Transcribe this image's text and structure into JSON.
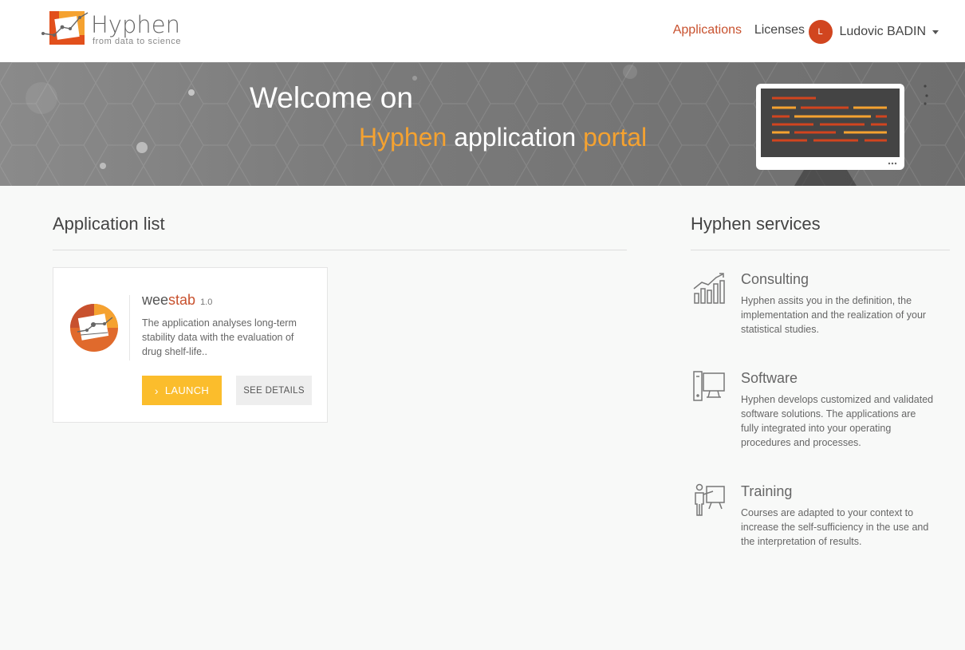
{
  "header": {
    "brand_name": "Hyphen",
    "brand_tagline": "from data to science",
    "nav": [
      {
        "label": "Applications",
        "active": true
      },
      {
        "label": "Licenses",
        "active": false
      }
    ],
    "user": {
      "initial": "L",
      "name": "Ludovic BADIN"
    }
  },
  "banner": {
    "line1": "Welcome on",
    "line2_part1": "Hyphen",
    "line2_part2": " application ",
    "line2_part3": "portal"
  },
  "apps_section": {
    "title": "Application list",
    "apps": [
      {
        "name_part1": "wee",
        "name_part2": "stab",
        "version": "1.0",
        "description": "The application analyses long-term stability data with the evaluation of drug shelf-life..",
        "launch_label": "LAUNCH",
        "details_label": "SEE DETAILS"
      }
    ]
  },
  "services_section": {
    "title": "Hyphen services",
    "items": [
      {
        "icon": "chart-growth-icon",
        "title": "Consulting",
        "description": "Hyphen assits you in the definition, the implementation and the realization of your statistical studies."
      },
      {
        "icon": "computer-icon",
        "title": "Software",
        "description": "Hyphen develops customized and validated software solutions. The applications are fully integrated into your operating procedures and processes."
      },
      {
        "icon": "presentation-icon",
        "title": "Training",
        "description": "Courses are adapted to your context to increase the self-sufficiency in the use and the interpretation of results."
      }
    ]
  },
  "colors": {
    "accent": "#c8512e",
    "highlight": "#f5a230",
    "launch": "#fbbd2c"
  }
}
